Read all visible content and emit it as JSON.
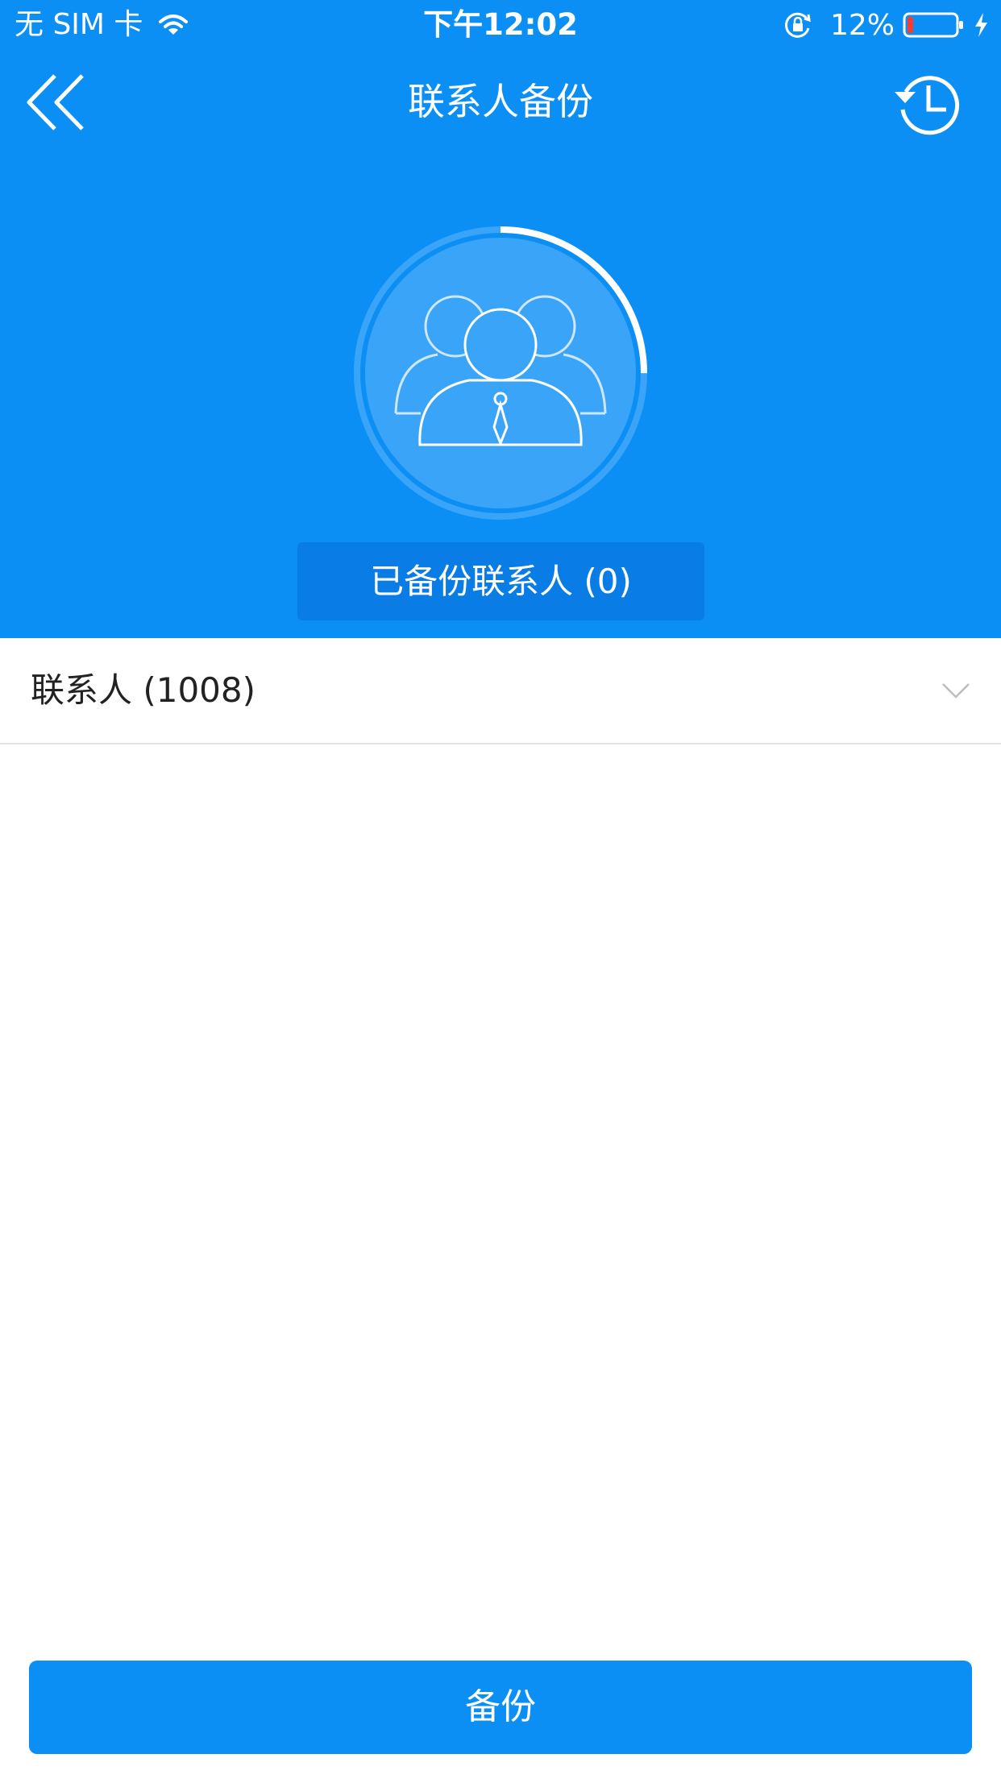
{
  "status_bar": {
    "carrier": "无 SIM 卡",
    "time": "下午12:02",
    "battery_percent": "12%",
    "battery_level": 0.12,
    "icons": [
      "wifi-icon",
      "rotation-lock-icon",
      "battery-icon",
      "charging-icon"
    ]
  },
  "nav": {
    "title": "联系人备份",
    "back_icon": "double-chevron-left-icon",
    "history_icon": "history-clock-icon"
  },
  "summary": {
    "avatar_icon": "contacts-group-icon",
    "backed_up_label": "已备份联系人 (0)",
    "progress_fraction": 0.25
  },
  "contacts_row": {
    "label": "联系人 (1008)",
    "chevron_icon": "chevron-down-icon"
  },
  "backup_button": {
    "label": "备份"
  },
  "colors": {
    "primary": "#0b8ff5",
    "header_button": "#0a7ce6",
    "battery_low": "#ff3b30"
  }
}
